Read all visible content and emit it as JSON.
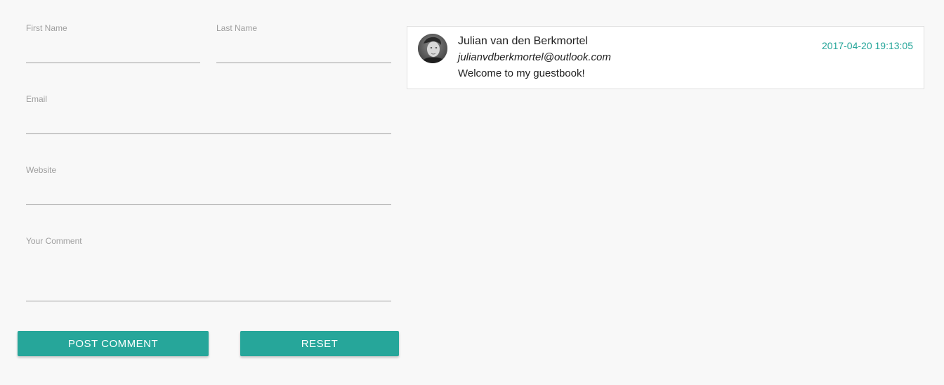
{
  "form": {
    "first_name": {
      "label": "First Name",
      "value": ""
    },
    "last_name": {
      "label": "Last Name",
      "value": ""
    },
    "email": {
      "label": "Email",
      "value": ""
    },
    "website": {
      "label": "Website",
      "value": ""
    },
    "comment": {
      "label": "Your Comment",
      "value": ""
    },
    "post_button_label": "POST COMMENT",
    "reset_button_label": "RESET"
  },
  "comments": [
    {
      "name": "Julian van den Berkmortel",
      "email": "julianvdberkmortel@outlook.com",
      "text": "Welcome to my guestbook!",
      "timestamp": "2017-04-20 19:13:05"
    }
  ],
  "colors": {
    "accent": "#26a69a",
    "background": "#f8f8f8",
    "input_line": "#9e9e9e",
    "label": "#9e9e9e"
  }
}
